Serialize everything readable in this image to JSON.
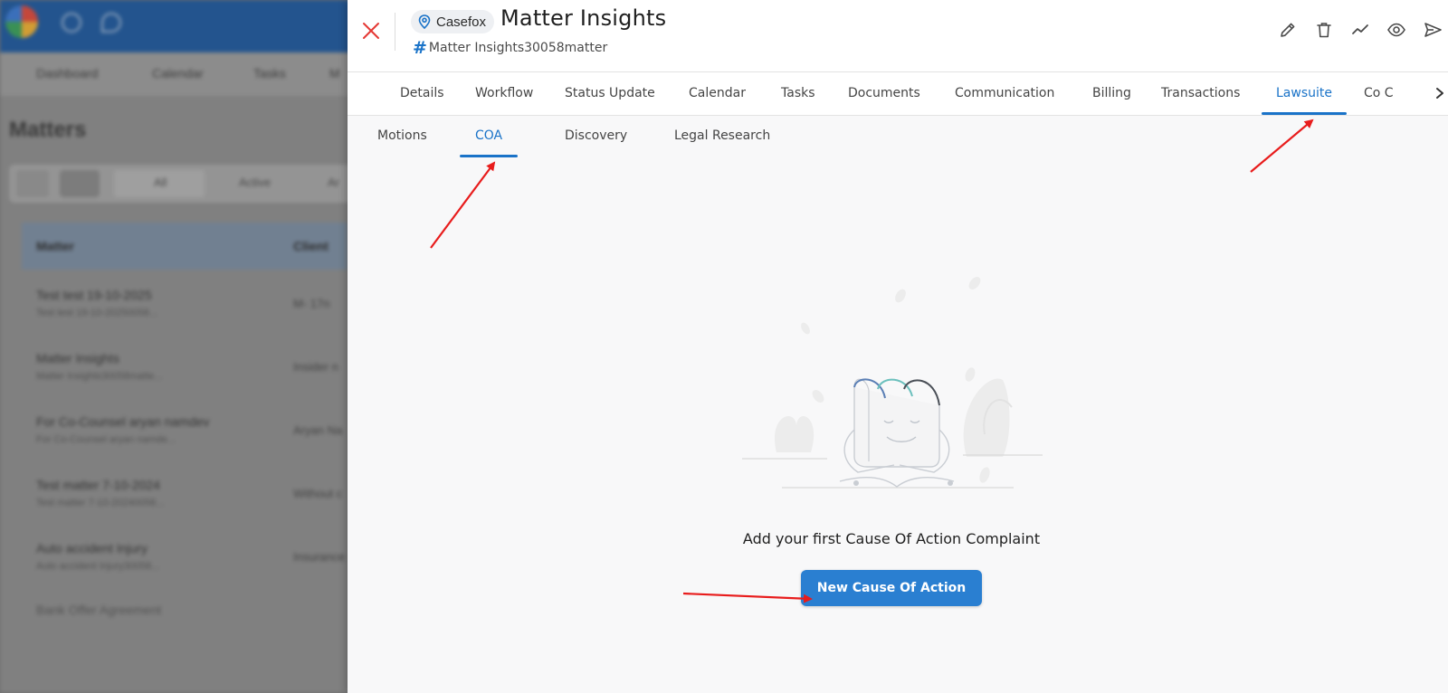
{
  "background_app": {
    "nav_items": [
      "Dashboard",
      "Calendar",
      "Tasks",
      "M"
    ],
    "page_title": "Matters",
    "toolbar": [
      "All",
      "Active",
      "Ar"
    ],
    "table_headers": [
      "Matter",
      "Client"
    ],
    "rows": [
      {
        "title": "Test test 19-10-2025",
        "sub": "Test test 19-10-20250058...",
        "client": "M- 17n"
      },
      {
        "title": "Matter Insights",
        "sub": "Matter Insights30058matte...",
        "client": "Insider n"
      },
      {
        "title": "For Co-Counsel aryan namdev",
        "sub": "For Co-Counsel aryan namde...",
        "client": "Aryan Na"
      },
      {
        "title": "Test matter 7-10-2024",
        "sub": "Test matter 7-10-20240058...",
        "client": "Without c"
      },
      {
        "title": "Auto accident Injury",
        "sub": "Auto accident Injury30058...",
        "client": "Insurance"
      },
      {
        "title": "Bank Offer Agreement",
        "sub": "",
        "client": ""
      }
    ]
  },
  "drawer": {
    "firm_chip": "Casefox",
    "matter_title": "Matter Insights",
    "matter_code": "Matter Insights30058matter",
    "actions": {
      "edit": "pencil-icon",
      "delete": "trash-icon",
      "insights": "trend-icon",
      "view": "eye-icon",
      "send": "send-icon"
    },
    "main_tabs": [
      "Details",
      "Workflow",
      "Status Update",
      "Calendar",
      "Tasks",
      "Documents",
      "Communication",
      "Billing",
      "Transactions",
      "Lawsuite",
      "Co C"
    ],
    "active_main_tab": "Lawsuite",
    "sub_tabs": [
      "Motions",
      "COA",
      "Discovery",
      "Legal Research"
    ],
    "active_sub_tab": "COA",
    "empty_state": {
      "message": "Add your first Cause Of Action Complaint",
      "button_label": "New Cause Of Action"
    }
  },
  "colors": {
    "accent": "#1a73c8",
    "button": "#2a7fd1",
    "close": "#e53935",
    "annotation_arrow": "#e81c1c",
    "topbar": "#1e5aa0"
  }
}
